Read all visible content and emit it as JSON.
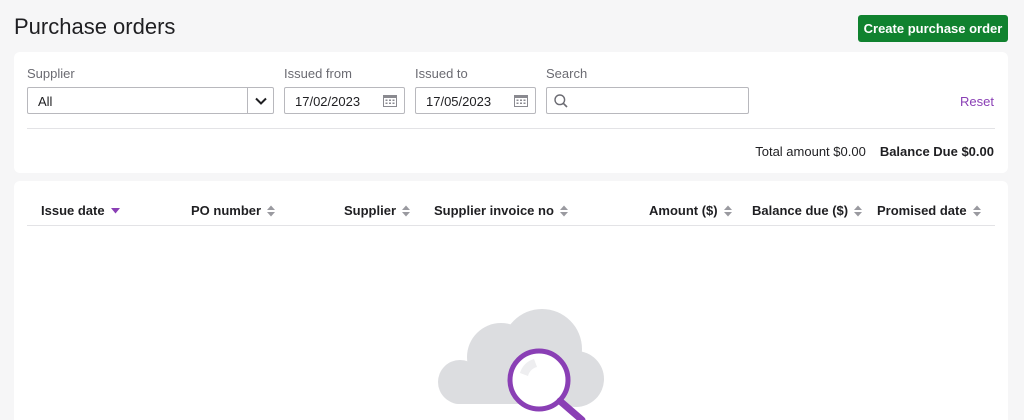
{
  "page": {
    "title": "Purchase orders"
  },
  "actions": {
    "create_label": "Create purchase order"
  },
  "filters": {
    "supplier": {
      "label": "Supplier",
      "value": "All"
    },
    "issued_from": {
      "label": "Issued from",
      "value": "17/02/2023"
    },
    "issued_to": {
      "label": "Issued to",
      "value": "17/05/2023"
    },
    "search": {
      "label": "Search",
      "value": "",
      "placeholder": ""
    },
    "reset_label": "Reset"
  },
  "totals": {
    "total_amount": "Total amount $0.00",
    "balance_due": "Balance Due $0.00"
  },
  "table": {
    "columns": [
      {
        "label": "Issue date",
        "sort": "desc"
      },
      {
        "label": "PO number",
        "sort": "none"
      },
      {
        "label": "Supplier",
        "sort": "none"
      },
      {
        "label": "Supplier invoice no",
        "sort": "none"
      },
      {
        "label": "Amount ($)",
        "sort": "none"
      },
      {
        "label": "Balance due ($)",
        "sort": "none"
      },
      {
        "label": "Promised date",
        "sort": "none"
      }
    ],
    "rows": []
  },
  "empty_state": {
    "icon": "cloud-search-icon"
  },
  "colors": {
    "primary_button": "#10822f",
    "accent": "#8a3fb5",
    "page_background": "#f6f6f7",
    "card_background": "#ffffff"
  }
}
